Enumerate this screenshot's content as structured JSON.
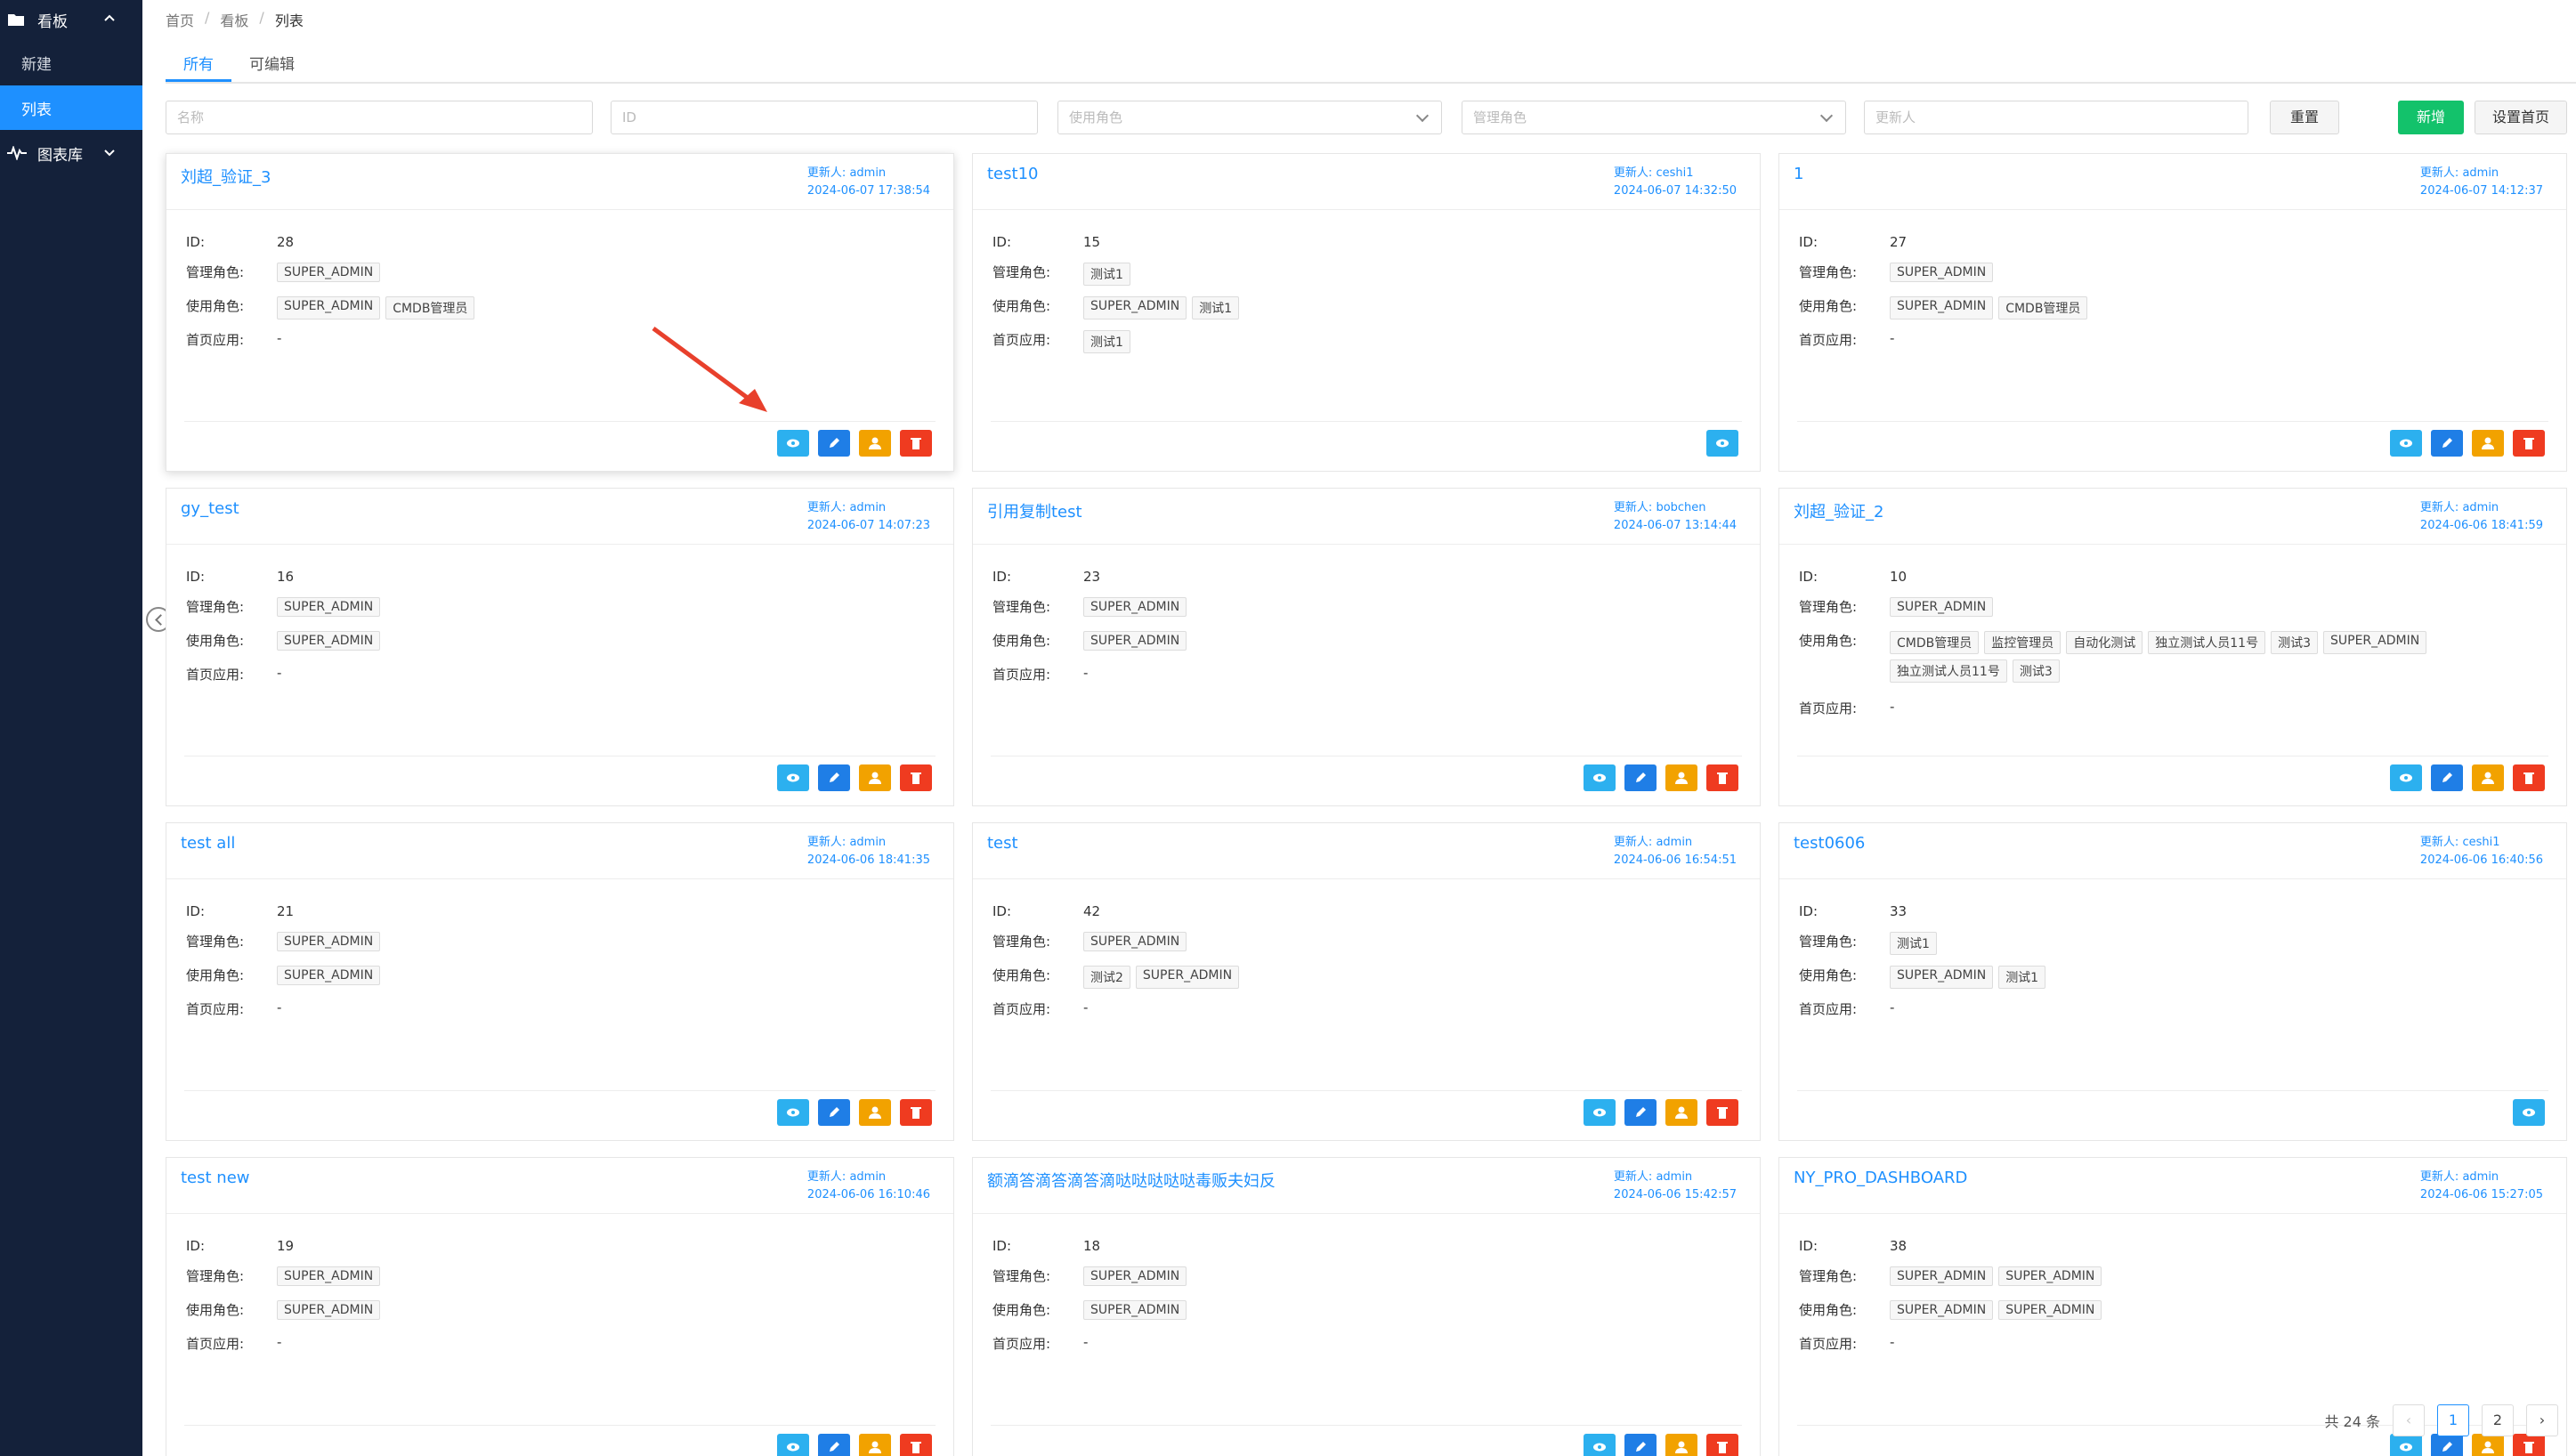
{
  "sidebar": {
    "group_dashboard": "看板",
    "item_new": "新建",
    "item_list": "列表",
    "group_charts": "图表库"
  },
  "breadcrumb": [
    "首页",
    "看板",
    "列表"
  ],
  "tabs": [
    "所有",
    "可编辑"
  ],
  "filters": {
    "name_placeholder": "名称",
    "id_placeholder": "ID",
    "use_role_placeholder": "使用角色",
    "admin_role_placeholder": "管理角色",
    "updater_placeholder": "更新人",
    "reset_label": "重置",
    "add_label": "新增",
    "set_home_label": "设置首页"
  },
  "labels": {
    "id": "ID:",
    "admin_roles": "管理角色:",
    "use_roles": "使用角色:",
    "home_apps": "首页应用:",
    "updater_prefix": "更新人: "
  },
  "cards": [
    {
      "title": "刘超_验证_3",
      "updater": "admin",
      "time": "2024-06-07 17:38:54",
      "id": "28",
      "admin_roles": [
        "SUPER_ADMIN"
      ],
      "use_roles": [
        "SUPER_ADMIN",
        "CMDB管理员"
      ],
      "home_apps": [],
      "home_dash": "-",
      "actions": [
        "view",
        "edit",
        "user",
        "del"
      ]
    },
    {
      "title": "test10",
      "updater": "ceshi1",
      "time": "2024-06-07 14:32:50",
      "id": "15",
      "admin_roles": [
        "测试1"
      ],
      "use_roles": [
        "SUPER_ADMIN",
        "测试1"
      ],
      "home_apps": [
        "测试1"
      ],
      "home_dash": "",
      "actions": [
        "view"
      ]
    },
    {
      "title": "1",
      "updater": "admin",
      "time": "2024-06-07 14:12:37",
      "id": "27",
      "admin_roles": [
        "SUPER_ADMIN"
      ],
      "use_roles": [
        "SUPER_ADMIN",
        "CMDB管理员"
      ],
      "home_apps": [],
      "home_dash": "-",
      "actions": [
        "view",
        "edit",
        "user",
        "del"
      ]
    },
    {
      "title": "gy_test",
      "updater": "admin",
      "time": "2024-06-07 14:07:23",
      "id": "16",
      "admin_roles": [
        "SUPER_ADMIN"
      ],
      "use_roles": [
        "SUPER_ADMIN"
      ],
      "home_apps": [],
      "home_dash": "-",
      "actions": [
        "view",
        "edit",
        "user",
        "del"
      ]
    },
    {
      "title": "引用复制test",
      "updater": "bobchen",
      "time": "2024-06-07 13:14:44",
      "id": "23",
      "admin_roles": [
        "SUPER_ADMIN"
      ],
      "use_roles": [
        "SUPER_ADMIN"
      ],
      "home_apps": [],
      "home_dash": "-",
      "actions": [
        "view",
        "edit",
        "user",
        "del"
      ]
    },
    {
      "title": "刘超_验证_2",
      "updater": "admin",
      "time": "2024-06-06 18:41:59",
      "id": "10",
      "admin_roles": [
        "SUPER_ADMIN"
      ],
      "use_roles": [
        "CMDB管理员",
        "监控管理员",
        "自动化测试",
        "独立测试人员11号",
        "测试3",
        "SUPER_ADMIN",
        "独立测试人员11号",
        "测试3"
      ],
      "home_apps": [],
      "home_dash": "-",
      "actions": [
        "view",
        "edit",
        "user",
        "del"
      ]
    },
    {
      "title": "test all",
      "updater": "admin",
      "time": "2024-06-06 18:41:35",
      "id": "21",
      "admin_roles": [
        "SUPER_ADMIN"
      ],
      "use_roles": [
        "SUPER_ADMIN"
      ],
      "home_apps": [],
      "home_dash": "-",
      "actions": [
        "view",
        "edit",
        "user",
        "del"
      ]
    },
    {
      "title": "test",
      "updater": "admin",
      "time": "2024-06-06 16:54:51",
      "id": "42",
      "admin_roles": [
        "SUPER_ADMIN"
      ],
      "use_roles": [
        "测试2",
        "SUPER_ADMIN"
      ],
      "home_apps": [],
      "home_dash": "-",
      "actions": [
        "view",
        "edit",
        "user",
        "del"
      ]
    },
    {
      "title": "test0606",
      "updater": "ceshi1",
      "time": "2024-06-06 16:40:56",
      "id": "33",
      "admin_roles": [
        "测试1"
      ],
      "use_roles": [
        "SUPER_ADMIN",
        "测试1"
      ],
      "home_apps": [],
      "home_dash": "-",
      "actions": [
        "view"
      ]
    },
    {
      "title": "test new",
      "updater": "admin",
      "time": "2024-06-06 16:10:46",
      "id": "19",
      "admin_roles": [
        "SUPER_ADMIN"
      ],
      "use_roles": [
        "SUPER_ADMIN"
      ],
      "home_apps": [],
      "home_dash": "-",
      "actions": [
        "view",
        "edit",
        "user",
        "del"
      ]
    },
    {
      "title": "额滴答滴答滴答滴哒哒哒哒哒毒贩夫妇反",
      "updater": "admin",
      "time": "2024-06-06 15:42:57",
      "id": "18",
      "admin_roles": [
        "SUPER_ADMIN"
      ],
      "use_roles": [
        "SUPER_ADMIN"
      ],
      "home_apps": [],
      "home_dash": "-",
      "actions": [
        "view",
        "edit",
        "user",
        "del"
      ]
    },
    {
      "title": "NY_PRO_DASHBOARD",
      "updater": "admin",
      "time": "2024-06-06 15:27:05",
      "id": "38",
      "admin_roles": [
        "SUPER_ADMIN",
        "SUPER_ADMIN"
      ],
      "use_roles": [
        "SUPER_ADMIN",
        "SUPER_ADMIN"
      ],
      "home_apps": [],
      "home_dash": "-",
      "actions": [
        "view",
        "edit",
        "user",
        "del"
      ]
    }
  ],
  "pagination": {
    "total_text": "共 24 条",
    "prev": "‹",
    "pages": [
      "1",
      "2"
    ],
    "next": "›",
    "current": "1"
  },
  "colors": {
    "sidebar_bg": "#14213a",
    "accent": "#1e90ff",
    "add_btn": "#13c26b",
    "view_btn": "#2cb0ef",
    "edit_btn": "#1f7ee6",
    "user_btn": "#f2a200",
    "del_btn": "#ef3b20"
  }
}
